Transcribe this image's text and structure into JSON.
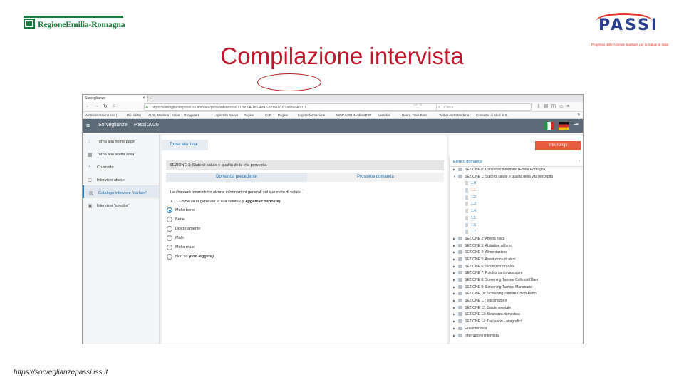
{
  "slide": {
    "title": "Compilazione intervista",
    "footer_url": "https://sorveglianzepassi.iss.it",
    "logo_left": "RegioneEmilia-Romagna",
    "logo_right": "PASSI",
    "logo_right_tagline": "Progressi delle Aziende Sanitarie per la Salute in Italia"
  },
  "browser": {
    "tab_title": "Sorveglianze",
    "url": "https://sorveglianzepassi.iss.it/#/data/passi/intervista/6717b094-1ff1-4aa2-87f8-02097aa8ad40/1.1",
    "search_placeholder": "Cerca",
    "bookmarks": [
      "Amministrazione sito (...",
      "Più visitati",
      "AUSL Modena | Intran...",
      "Groupware",
      "Login Sito Nuovo",
      "Pagine",
      "CoF",
      "Pagine",
      "Login Informazione",
      "NEW AUSL Modena",
      "DSP",
      "passidati",
      "DeepL Traduttore",
      "Twitter AUSLModena",
      "Consumo di alcol in It..."
    ]
  },
  "app": {
    "brand": "Sorveglianze",
    "section": "Passi 2020"
  },
  "sidebar": {
    "items": [
      {
        "label": "Torna alla home page",
        "icon": "home-icon"
      },
      {
        "label": "Torna alla scelta area",
        "icon": "grid-icon"
      },
      {
        "label": "Cruscotto",
        "icon": "dashboard-icon"
      },
      {
        "label": "Interviste attese",
        "icon": "list-icon"
      },
      {
        "label": "Catalogo interviste \"da fare\"",
        "icon": "clipboard-icon",
        "active": true
      },
      {
        "label": "Interviste \"spedite\"",
        "icon": "clipboard-check-icon"
      }
    ]
  },
  "main": {
    "back_label": "Torna alla lista",
    "section_title": "SEZIONE 1: Stato di salute e qualità della vita percepita",
    "prev_label": "Domanda precedente",
    "next_label": "Prossima domanda",
    "intro": "Le chiederò innanzitutto alcune informazioni generali sul suo stato di salute...",
    "question": "1.1 - Come va in generale la sua salute?",
    "question_note": "(Leggere le risposte)",
    "options": [
      {
        "label": "Molto bene",
        "selected": true
      },
      {
        "label": "Bene",
        "selected": false
      },
      {
        "label": "Discretamente",
        "selected": false
      },
      {
        "label": "Male",
        "selected": false
      },
      {
        "label": "Molto male",
        "selected": false
      },
      {
        "label": "Non so",
        "note": "(non leggere)",
        "selected": false
      }
    ]
  },
  "right": {
    "stop_label": "Interrompi",
    "tree_title": "Elenco domande",
    "tree": [
      {
        "label": "SEZIONE 0: Consenso informato (Emilia Romagna)",
        "type": "folder",
        "expanded": false
      },
      {
        "label": "SEZIONE 1: Stato di salute e qualità della vita percepita",
        "type": "folder",
        "expanded": true
      },
      {
        "label": "1.0",
        "type": "item"
      },
      {
        "label": "1.1",
        "type": "item",
        "current": true
      },
      {
        "label": "1.2",
        "type": "item"
      },
      {
        "label": "1.3",
        "type": "item"
      },
      {
        "label": "1.4",
        "type": "item"
      },
      {
        "label": "1.5",
        "type": "item"
      },
      {
        "label": "1.6",
        "type": "item"
      },
      {
        "label": "1.7",
        "type": "item"
      },
      {
        "label": "SEZIONE 2: Attività fisica",
        "type": "folder"
      },
      {
        "label": "SEZIONE 3: Abitudine al fumo",
        "type": "folder"
      },
      {
        "label": "SEZIONE 4: Alimentazione",
        "type": "folder"
      },
      {
        "label": "SEZIONE 5: Assunzione di alcol",
        "type": "folder"
      },
      {
        "label": "SEZIONE 6: Sicurezza stradale",
        "type": "folder"
      },
      {
        "label": "SEZIONE 7: Rischio cardiovascolare",
        "type": "folder"
      },
      {
        "label": "SEZIONE 8: Screening Tumore Collo dell'Utero",
        "type": "folder"
      },
      {
        "label": "SEZIONE 9: Screening Tumore Mammario",
        "type": "folder"
      },
      {
        "label": "SEZIONE 10: Screening Tumore Colon-Retto",
        "type": "folder"
      },
      {
        "label": "SEZIONE 11: Vaccinazioni",
        "type": "folder"
      },
      {
        "label": "SEZIONE 12: Salute mentale",
        "type": "folder"
      },
      {
        "label": "SEZIONE 13: Sicurezza domestica",
        "type": "folder"
      },
      {
        "label": "SEZIONE 14: Dati socio - anagrafici",
        "type": "folder"
      },
      {
        "label": "Fine intervista",
        "type": "folder"
      },
      {
        "label": "Interruzione intervista",
        "type": "folder"
      }
    ]
  }
}
